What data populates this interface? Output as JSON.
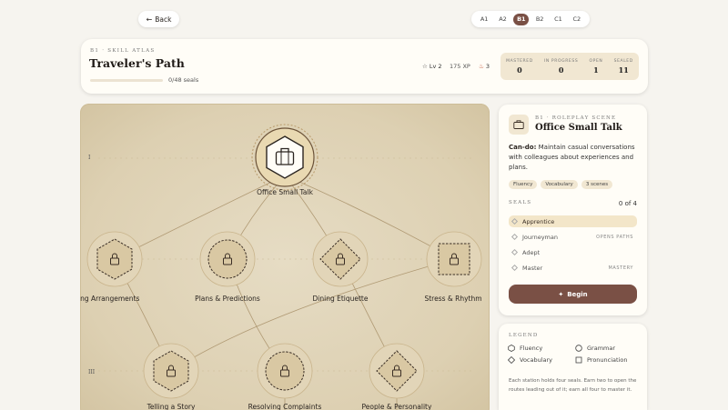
{
  "nav": {
    "back_label": "Back"
  },
  "levels": {
    "items": [
      "A1",
      "A2",
      "B1",
      "B2",
      "C1",
      "C2"
    ],
    "active": "B1"
  },
  "header": {
    "eyebrow": "B1 · SKILL ATLAS",
    "title": "Traveler's Path",
    "progress_label": "0/48 seals",
    "progress_fraction": 0,
    "level_label": "Lv 2",
    "xp_label": "175 XP",
    "streak_label": "3",
    "stats": [
      {
        "label": "MASTERED",
        "value": "0"
      },
      {
        "label": "IN PROGRESS",
        "value": "0"
      },
      {
        "label": "OPEN",
        "value": "1"
      },
      {
        "label": "SEALED",
        "value": "11"
      }
    ]
  },
  "map": {
    "row_numerals": [
      "I",
      "III"
    ],
    "nodes": [
      {
        "label": "Office Small Talk",
        "shape": "hexagon",
        "state": "open",
        "icon": "briefcase-icon"
      },
      {
        "label": "Making Arrangements",
        "shape": "hexagon",
        "state": "sealed",
        "icon": "lock-icon"
      },
      {
        "label": "Plans & Predictions",
        "shape": "circle",
        "state": "sealed",
        "icon": "lock-icon"
      },
      {
        "label": "Dining Etiquette",
        "shape": "diamond",
        "state": "sealed",
        "icon": "lock-icon"
      },
      {
        "label": "Stress & Rhythm",
        "shape": "square",
        "state": "sealed",
        "icon": "lock-icon"
      },
      {
        "label": "Telling a Story",
        "shape": "hexagon",
        "state": "sealed",
        "icon": "lock-icon"
      },
      {
        "label": "Resolving Complaints",
        "shape": "circle",
        "state": "sealed",
        "icon": "lock-icon"
      },
      {
        "label": "People & Personality",
        "shape": "diamond",
        "state": "sealed",
        "icon": "lock-icon"
      }
    ]
  },
  "scene": {
    "eyebrow": "B1 · ROLEPLAY SCENE",
    "title": "Office Small Talk",
    "cando_label": "Can-do:",
    "cando_text": "Maintain casual conversations with colleagues about experiences and plans.",
    "tags": [
      "Fluency",
      "Vocabulary",
      "3 scenes"
    ],
    "seals_label": "SEALS",
    "seals_count": "0 of 4",
    "seals": [
      {
        "name": "Apprentice",
        "note": ""
      },
      {
        "name": "Journeyman",
        "note": "OPENS PATHS"
      },
      {
        "name": "Adept",
        "note": ""
      },
      {
        "name": "Master",
        "note": "MASTERY"
      }
    ],
    "begin_label": "Begin"
  },
  "legend": {
    "title": "LEGEND",
    "items": [
      {
        "label": "Fluency",
        "shape": "hexagon"
      },
      {
        "label": "Grammar",
        "shape": "circle"
      },
      {
        "label": "Vocabulary",
        "shape": "diamond"
      },
      {
        "label": "Pronunciation",
        "shape": "square"
      }
    ],
    "note": "Each station holds four seals. Earn two to open the routes leading out of it; earn all four to master it."
  },
  "colors": {
    "accent": "#7a5045",
    "parchment": "#e2d6bb",
    "gold": "#b89a6a"
  }
}
